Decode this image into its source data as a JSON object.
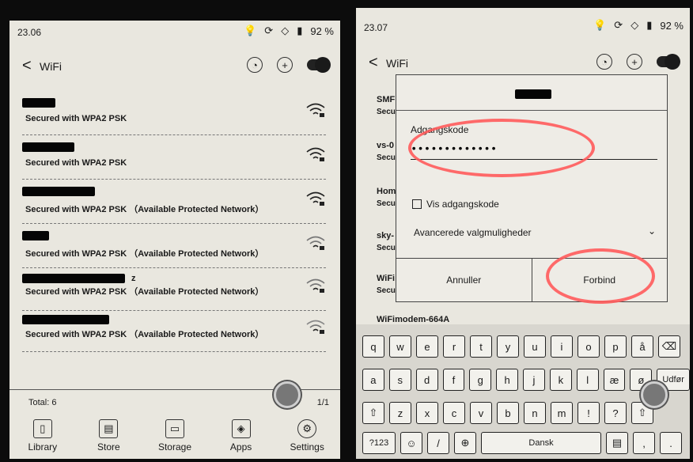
{
  "left": {
    "status": {
      "time": "23.06",
      "battery": "92 %"
    },
    "topbar": {
      "back": "<",
      "title": "WiFi"
    },
    "networks": [
      {
        "ssid_tail": "",
        "security": "Secured with WPA2 PSK"
      },
      {
        "ssid_tail": "",
        "security": "Secured with WPA2 PSK"
      },
      {
        "ssid_tail": "",
        "security": "Secured with WPA2 PSK （Available Protected Network）"
      },
      {
        "ssid_tail": "",
        "security": "Secured with WPA2 PSK （Available Protected Network）"
      },
      {
        "ssid_tail": "z",
        "security": "Secured with WPA2 PSK （Available Protected Network）"
      },
      {
        "ssid_tail": "",
        "security": "Secured with WPA2 PSK （Available Protected Network）"
      }
    ],
    "footer": {
      "total": "Total: 6",
      "page": "1/1"
    },
    "dock": [
      "Library",
      "Store",
      "Storage",
      "Apps",
      "Settings"
    ]
  },
  "right": {
    "status": {
      "time": "23.07",
      "battery": "92 %"
    },
    "topbar": {
      "back": "<",
      "title": "WiFi"
    },
    "bg_networks": [
      {
        "name": "SMF",
        "sec": "Secu"
      },
      {
        "name": "vs-0",
        "sec": "Secu"
      },
      {
        "name": "Hom",
        "sec": "Secu"
      },
      {
        "name": "sky-",
        "sec": "Secu"
      },
      {
        "name": "WiFi",
        "sec": "Secu"
      },
      {
        "name": "WiFimodem-664A",
        "sec": ""
      }
    ],
    "dialog": {
      "password_label": "Adgangskode",
      "password_value": "•••••••••••••",
      "show_password": "Vis adgangskode",
      "advanced": "Avancerede valgmuligheder",
      "cancel": "Annuller",
      "connect": "Forbind"
    },
    "keyboard": {
      "row1": [
        "q",
        "w",
        "e",
        "r",
        "t",
        "y",
        "u",
        "i",
        "o",
        "p",
        "å"
      ],
      "row2": [
        "a",
        "s",
        "d",
        "f",
        "g",
        "h",
        "j",
        "k",
        "l",
        "æ",
        "ø"
      ],
      "row3": [
        "z",
        "x",
        "c",
        "v",
        "b",
        "n",
        "m",
        "!",
        "?"
      ],
      "num_key": "?123",
      "lang_key": "Dansk",
      "enter_key": "Udfør"
    }
  },
  "colors": {
    "annotation": "#ff5b5b",
    "eink_bg": "#e9e7df"
  }
}
